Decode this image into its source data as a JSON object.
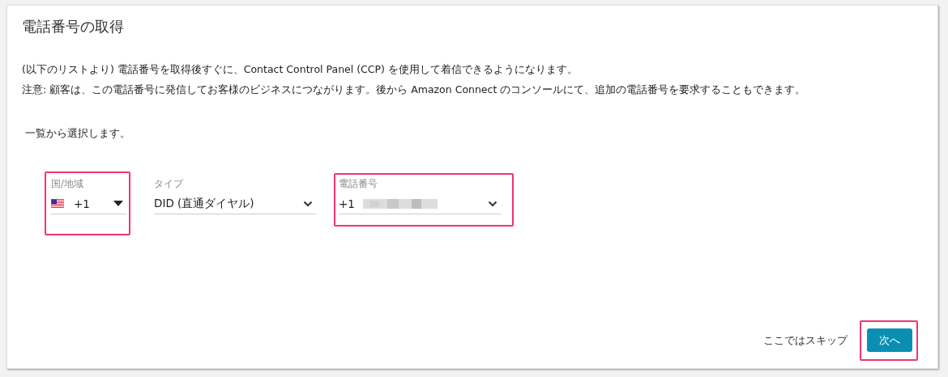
{
  "title": "電話番号の取得",
  "description": [
    "(以下のリストより) 電話番号を取得後すぐに、Contact Control Panel (CCP) を使用して着信できるようになります。",
    "注意: 顧客は、この電話番号に発信してお客様のビジネスにつながります。後から Amazon Connect のコンソールにて、追加の電話番号を要求することもできます。"
  ],
  "instruction": "一覧から選択します。",
  "fields": [
    {
      "kind": "country",
      "label": "国/地域",
      "value": "+1",
      "highlighted": true
    },
    {
      "kind": "select",
      "label": "タイプ",
      "value": "DID (直通ダイヤル)",
      "highlighted": false
    },
    {
      "kind": "number",
      "label": "電話番号",
      "value": "+1",
      "highlighted": true
    }
  ],
  "skip": "ここではスキップ",
  "next": {
    "label": "次へ",
    "highlighted": true
  }
}
